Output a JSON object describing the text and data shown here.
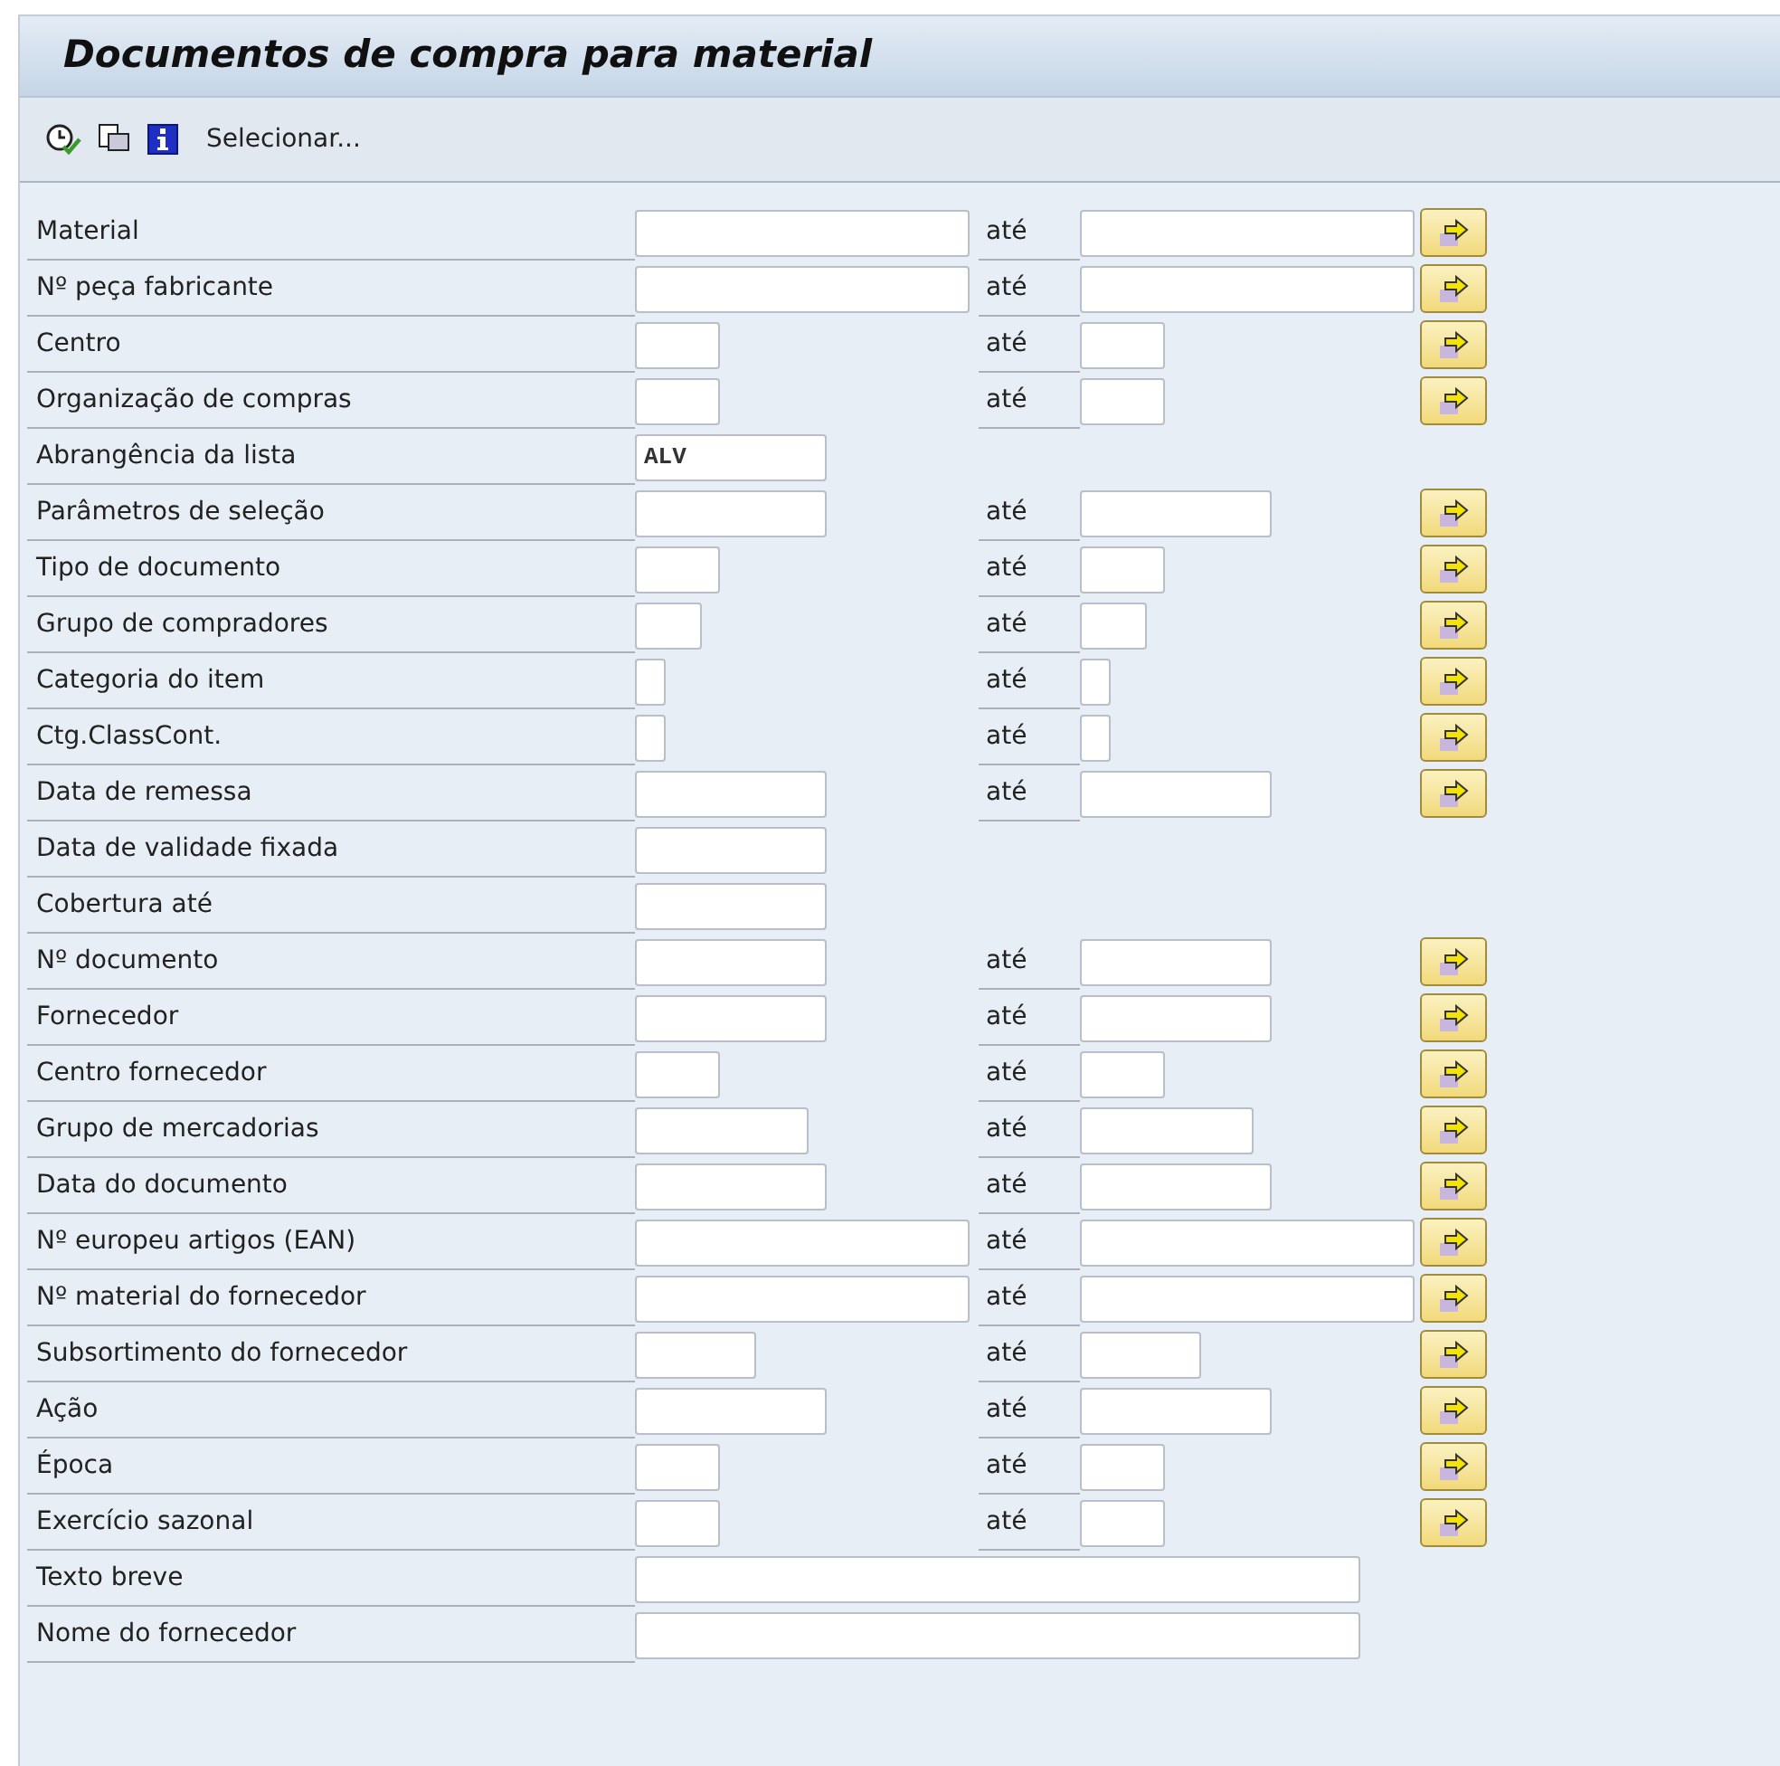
{
  "window": {
    "title": "Documentos de compra para material"
  },
  "toolbar": {
    "label": "Selecionar..."
  },
  "rows": [
    {
      "label": "Material",
      "kind": "long",
      "to_label": "até"
    },
    {
      "label": "Nº peça fabricante",
      "kind": "long",
      "to_label": "até"
    },
    {
      "label": "Centro",
      "kind": "short",
      "to_label": "até"
    },
    {
      "label": "Organização de compras",
      "kind": "short",
      "to_label": "até"
    },
    {
      "label": "Abrangência da lista",
      "kind": "medium",
      "value": "ALV"
    },
    {
      "label": "Parâmetros de seleção",
      "kind": "medium",
      "to_label": "até"
    },
    {
      "label": "Tipo de documento",
      "kind": "short",
      "to_label": "até"
    },
    {
      "label": "Grupo de compradores",
      "kind": "narrow",
      "to_label": "até"
    },
    {
      "label": "Categoria do item",
      "kind": "tiny",
      "to_label": "até"
    },
    {
      "label": "Ctg.ClassCont.",
      "kind": "tiny",
      "to_label": "até"
    },
    {
      "label": "Data de remessa",
      "kind": "medium",
      "to_label": "até"
    },
    {
      "label": "Data de validade fixada",
      "kind": "medium"
    },
    {
      "label": "Cobertura até",
      "kind": "medium"
    },
    {
      "label": "Nº documento",
      "kind": "medium",
      "to_label": "até"
    },
    {
      "label": "Fornecedor",
      "kind": "medium",
      "to_label": "até"
    },
    {
      "label": "Centro fornecedor",
      "kind": "short",
      "to_label": "até"
    },
    {
      "label": "Grupo de mercadorias",
      "kind": "mediumshort",
      "to_label": "até"
    },
    {
      "label": "Data do documento",
      "kind": "medium",
      "to_label": "até"
    },
    {
      "label": "Nº europeu artigos (EAN)",
      "kind": "long",
      "to_label": "até"
    },
    {
      "label": "Nº material do fornecedor",
      "kind": "long",
      "to_label": "até"
    },
    {
      "label": "Subsortimento do fornecedor",
      "kind": "shortish",
      "to_label": "até"
    },
    {
      "label": "Ação",
      "kind": "medium",
      "to_label": "até"
    },
    {
      "label": "Época",
      "kind": "short",
      "to_label": "até"
    },
    {
      "label": "Exercício sazonal",
      "kind": "short",
      "to_label": "até"
    },
    {
      "label": "Texto breve",
      "kind": "wide"
    },
    {
      "label": "Nome do fornecedor",
      "kind": "wide"
    }
  ]
}
